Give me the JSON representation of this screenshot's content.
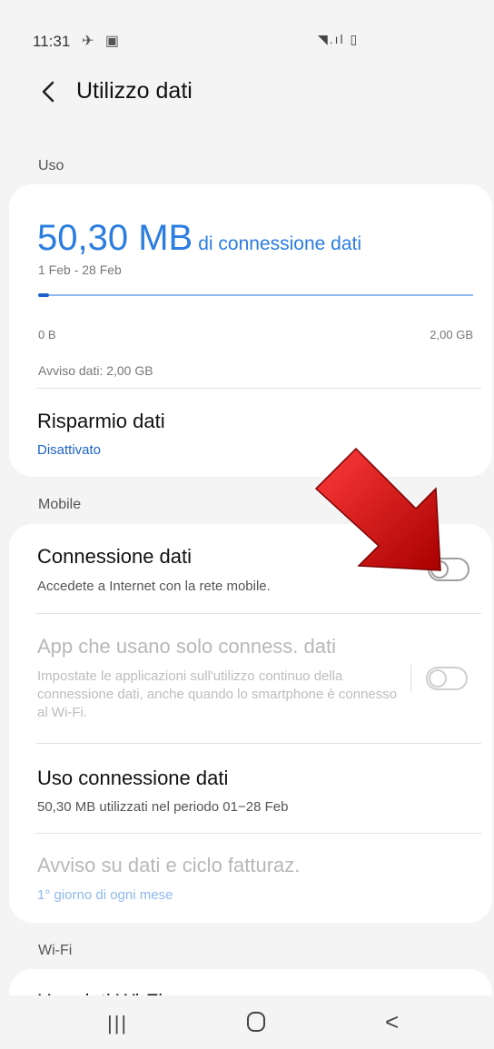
{
  "status": {
    "time": "11:31",
    "left_icons": "✈ ▣",
    "right_icons": "◥.ıl ▯"
  },
  "header": {
    "title": "Utilizzo dati",
    "back_icon": "chevron-left-icon"
  },
  "sections": {
    "uso": "Uso",
    "mobile": "Mobile",
    "wifi": "Wi-Fi"
  },
  "usage": {
    "amount": "50,30 MB",
    "unit_label": "di connessione dati",
    "period": "1 Feb - 28 Feb",
    "range_min": "0 B",
    "range_max": "2,00 GB",
    "progress_fraction": 0.025,
    "alert": "Avviso dati: 2,00 GB"
  },
  "data_saver": {
    "title": "Risparmio dati",
    "status": "Disattivato"
  },
  "mobile_rows": {
    "data_connection": {
      "title": "Connessione dati",
      "subtitle": "Accedete a Internet con la rete mobile.",
      "enabled": false
    },
    "apps_only": {
      "title": "App che usano solo conness. dati",
      "subtitle": "Impostate le applicazioni sull'utilizzo continuo della connessione dati, anche quando lo smartphone è connesso al Wi-Fi.",
      "enabled": false
    },
    "usage": {
      "title": "Uso connessione dati",
      "subtitle": "50,30 MB utilizzati nel periodo 01−28 Feb"
    },
    "billing": {
      "title": "Avviso su dati e ciclo fatturaz.",
      "subtitle": "1° giorno di ogni mese"
    }
  },
  "wifi_row": {
    "title": "Uso dati Wi-Fi"
  },
  "navbar": {
    "recent_label": "|||",
    "back_label": "<"
  },
  "colors": {
    "accent": "#2b7de0",
    "arrow": "#d40000"
  }
}
